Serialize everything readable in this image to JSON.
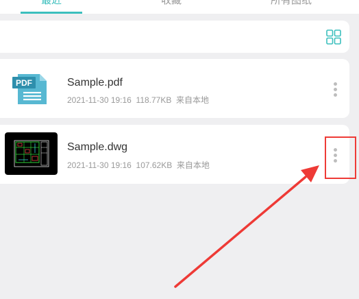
{
  "tabs": [
    {
      "label": "最近"
    },
    {
      "label": "收藏"
    },
    {
      "label": "所有图纸"
    }
  ],
  "toolbar": {
    "view_icon": "grid-view-icon"
  },
  "files": [
    {
      "name": "Sample.pdf",
      "date": "2021-11-30 19:16",
      "size": "118.77KB",
      "source": "来自本地",
      "thumb_label": "PDF"
    },
    {
      "name": "Sample.dwg",
      "date": "2021-11-30 19:16",
      "size": "107.62KB",
      "source": "来自本地"
    }
  ],
  "colors": {
    "accent": "#3bbfbd",
    "annotation": "#ee3a36"
  }
}
